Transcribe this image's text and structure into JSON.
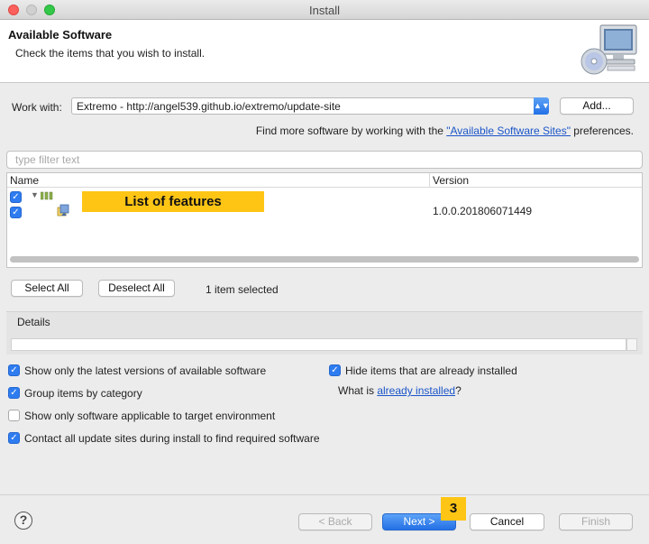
{
  "window": {
    "title": "Install"
  },
  "banner": {
    "title": "Available Software",
    "description": "Check the items that you wish to install.",
    "icon": "install-cd-monitor-icon"
  },
  "work_with": {
    "label": "Work with:",
    "value": "Extremo - http://angel539.github.io/extremo/update-site",
    "add_label": "Add..."
  },
  "find_more": {
    "prefix": "Find more software by working with the ",
    "link": "\"Available Software Sites\"",
    "suffix": " preferences."
  },
  "filter": {
    "placeholder": "type filter text"
  },
  "table": {
    "columns": [
      "Name",
      "Version"
    ],
    "rows": [
      {
        "checked": true,
        "name": "",
        "version": ""
      },
      {
        "checked": true,
        "name": "",
        "version": "1.0.0.201806071449"
      }
    ],
    "annotation": "List of features"
  },
  "selection": {
    "select_all": "Select All",
    "deselect_all": "Deselect All",
    "count_text": "1 item selected"
  },
  "details": {
    "label": "Details"
  },
  "options": {
    "latest_versions": {
      "label": "Show only the latest versions of available software",
      "checked": true
    },
    "group_by_category": {
      "label": "Group items by category",
      "checked": true
    },
    "target_env": {
      "label": "Show only software applicable to target environment",
      "checked": false
    },
    "contact_sites": {
      "label": "Contact all update sites during install to find required software",
      "checked": true
    },
    "hide_installed": {
      "label": "Hide items that are already installed",
      "checked": true
    },
    "what_is_prefix": "What is ",
    "what_is_link": "already installed",
    "what_is_suffix": "?"
  },
  "footer": {
    "help": "?",
    "back": "< Back",
    "next": "Next >",
    "cancel": "Cancel",
    "finish": "Finish",
    "step_badge": "3"
  },
  "colors": {
    "accent": "#2e7cf0",
    "annotation": "#fec515",
    "link": "#1a55c8"
  }
}
